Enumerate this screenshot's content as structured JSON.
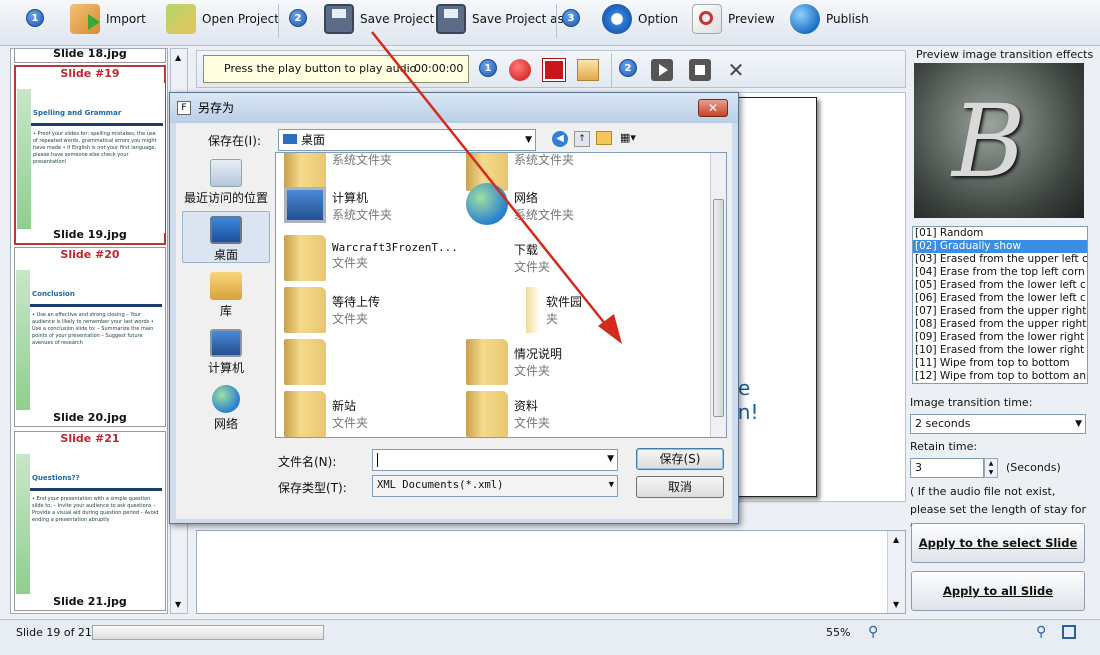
{
  "toolbar": {
    "steps": [
      "1",
      "2",
      "3"
    ],
    "import": "Import",
    "open_project": "Open Project",
    "save_project": "Save Project",
    "save_project_as": "Save Project as",
    "option": "Option",
    "preview": "Preview",
    "publish": "Publish"
  },
  "slides": [
    {
      "footer": "Slide 18.jpg"
    },
    {
      "header": "Slide #19",
      "title": "Spelling and Grammar",
      "text": "• Proof your slides for: spelling mistakes, the use of repeated words, grammatical errors you might have made • If English is not your first language, please have someone else check your presentation!",
      "footer": "Slide 19.jpg"
    },
    {
      "header": "Slide #20",
      "title": "Conclusion",
      "text": "• Use an effective and strong closing – Your audience is likely to remember your last words • Use a conclusion slide to: – Summarize the main points of your presentation – Suggest future avenues of research",
      "footer": "Slide 20.jpg"
    },
    {
      "header": "Slide #21",
      "title": "Questions??",
      "text": "• End your presentation with a simple question slide to: – Invite your audience to ask questions – Provide a visual aid during question period – Avoid ending a presentation abruptly",
      "footer": "Slide 21.jpg"
    }
  ],
  "playbar": {
    "message": "Press the play button to play audio.",
    "time": "00:00:00",
    "steps": [
      "1",
      "2"
    ]
  },
  "preview": {
    "text_line1": "e",
    "text_line2": "ion!"
  },
  "dialog": {
    "title": "另存为",
    "save_in_label": "保存在(I):",
    "save_in_value": "桌面",
    "places": [
      "最近访问的位置",
      "桌面",
      "库",
      "计算机",
      "网络"
    ],
    "files": [
      {
        "name": "",
        "type": "系统文件夹"
      },
      {
        "name": "",
        "type": "系统文件夹"
      },
      {
        "name": "计算机",
        "type": "系统文件夹"
      },
      {
        "name": "网络",
        "type": "系统文件夹"
      },
      {
        "name": "Warcraft3FrozenT...",
        "type": "文件夹"
      },
      {
        "name": "下载",
        "type": "文件夹"
      },
      {
        "name": "等待上传",
        "type": "文件夹"
      },
      {
        "name": "软件园",
        "type": "夹"
      },
      {
        "name": "",
        "type": ""
      },
      {
        "name": "情况说明",
        "type": "文件夹"
      },
      {
        "name": "新站",
        "type": "文件夹"
      },
      {
        "name": "资料",
        "type": "文件夹"
      }
    ],
    "filename_label": "文件名(N):",
    "filename_value": "",
    "filetype_label": "保存类型(T):",
    "filetype_value": "XML Documents(*.xml)",
    "save_button": "保存(S)",
    "cancel_button": "取消"
  },
  "right_panel": {
    "header": "Preview image transition effects",
    "preview_letter": "B",
    "effects": [
      "[01] Random",
      "[02] Gradually show",
      "[03] Erased from the upper left c",
      "[04] Erase from the top left corn",
      "[05] Erased from the lower left c",
      "[06] Erased from the lower left c",
      "[07] Erased from the upper right",
      "[08] Erased from the upper right",
      "[09] Erased from the lower right",
      "[10] Erased from the lower right",
      "[11] Wipe from top to bottom",
      "[12] Wipe from top to bottom an"
    ],
    "selected_effect": 1,
    "transition_label": "Image transition time:",
    "transition_value": "2 seconds",
    "retain_label": "Retain time:",
    "retain_value": "3",
    "retain_unit": "(Seconds)",
    "note": "( If the audio file not exist, please set the length of stay for this page )",
    "apply_select": "Apply to the select Slide",
    "apply_all": "Apply to all Slide"
  },
  "status": {
    "slide_info": "Slide 19 of 21",
    "zoom": "55%"
  },
  "colors": {
    "accent": "#3a8ee6",
    "slide_header": "#c0272d",
    "annotation_arrow": "#d42a1c"
  }
}
